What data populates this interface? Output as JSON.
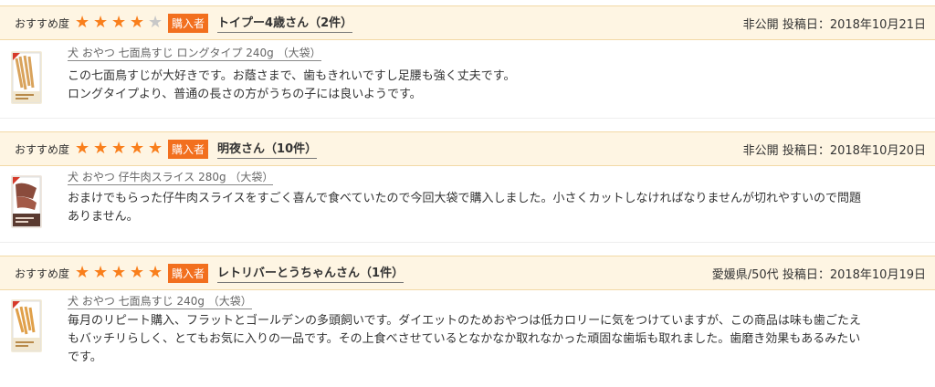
{
  "recommend_label": "おすすめ度",
  "buyer_badge": "購入者",
  "meta_separator": "投稿日：",
  "colors": {
    "star_on": "#f97f1c",
    "star_off": "#c8c8c8",
    "badge": "#f26f1e",
    "header_bg": "#fef5e3"
  },
  "reviews": [
    {
      "rating": 4,
      "reviewer": "トイプー4歳さん（2件）",
      "author_info": "非公開",
      "date": "2018年10月21日",
      "product": "犬 おやつ 七面鳥すじ ロングタイプ 240g （大袋）",
      "thumb_icon": "treat-bag-icon",
      "lines": [
        "この七面鳥すじが大好きです。お蔭さまで、歯もきれいですし足腰も強く丈夫です。",
        "ロングタイプより、普通の長さの方がうちの子には良いようです。"
      ]
    },
    {
      "rating": 5,
      "reviewer": "明夜さん（10件）",
      "author_info": "非公開",
      "date": "2018年10月20日",
      "product": "犬 おやつ 仔牛肉スライス 280g （大袋）",
      "thumb_icon": "treat-bag-icon",
      "lines": [
        "おまけでもらった仔牛肉スライスをすごく喜んで食べていたので今回大袋で購入しました。小さくカットしなければなりませんが切れやすいので問題",
        "ありません。"
      ]
    },
    {
      "rating": 5,
      "reviewer": "レトリバーとうちゃんさん（1件）",
      "author_info": "愛媛県/50代",
      "date": "2018年10月19日",
      "product": "犬 おやつ 七面鳥すじ 240g （大袋）",
      "thumb_icon": "treat-bag-icon",
      "lines": [
        "毎月のリピート購入、フラットとゴールデンの多頭飼いです。ダイエットのためおやつは低カロリーに気をつけていますが、この商品は味も歯ごたえ",
        "もバッチリらしく、とてもお気に入りの一品です。その上食べさせているとなかなか取れなかった頑固な歯垢も取れました。歯磨き効果もあるみたい",
        "です。"
      ]
    }
  ]
}
